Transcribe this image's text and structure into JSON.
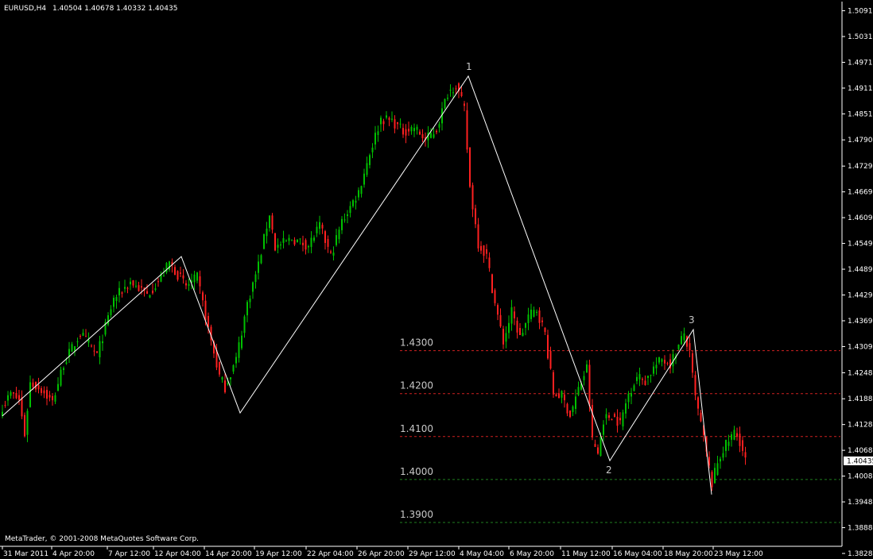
{
  "header": {
    "symbol": "EURUSD,H4",
    "quote": "1.40504 1.40678 1.40332 1.40435"
  },
  "footer": {
    "copyright": "MetaTrader, © 2001-2008 MetaQuotes Software Corp."
  },
  "colors": {
    "background": "#000000",
    "axis": "#ffffff",
    "bull_candle": "#00c000",
    "bear_candle": "#ff2020",
    "wick": "#00c000",
    "zigzag": "#ffffff",
    "resistance_line": "#d02020",
    "support_line": "#208020",
    "current_price_tag": "#ffffff"
  },
  "chart_data": {
    "type": "candlestick",
    "symbol": "EURUSD",
    "timeframe": "H4",
    "current_price": "1.40435",
    "ylim": [
      1.3828,
      1.5092
    ],
    "y_ticks": [
      "1.50910",
      "1.50310",
      "1.49710",
      "1.49110",
      "1.48510",
      "1.47905",
      "1.47295",
      "1.46695",
      "1.46095",
      "1.45495",
      "1.44895",
      "1.44295",
      "1.43695",
      "1.43095",
      "1.42485",
      "1.41880",
      "1.41280",
      "1.40680",
      "1.40080",
      "1.39480",
      "1.38880",
      "1.38280"
    ],
    "x_ticks": [
      "31 Mar 2011",
      "4 Apr 20:00",
      "7 Apr 12:00",
      "12 Apr 04:00",
      "14 Apr 20:00",
      "19 Apr 12:00",
      "22 Apr 04:00",
      "26 Apr 20:00",
      "29 Apr 12:00",
      "4 May 04:00",
      "6 May 20:00",
      "11 May 12:00",
      "16 May 04:00",
      "18 May 20:00",
      "23 May 12:00"
    ],
    "zigzag_path": [
      {
        "date": "31 Mar 2011",
        "price": 1.4148
      },
      {
        "date": "12 Apr 04:00",
        "price": 1.4519
      },
      {
        "date": "14 Apr 20:00",
        "price": 1.4155
      },
      {
        "date": "4 May 04:00",
        "price": 1.4939
      },
      {
        "date": "16 May 04:00",
        "price": 1.4044
      },
      {
        "date": "18 May 20:00",
        "price": 1.4349
      },
      {
        "date": "23 May 12:00",
        "price": 1.3965
      }
    ],
    "wave_labels": [
      {
        "label": "1",
        "price": 1.4939
      },
      {
        "label": "2",
        "price": 1.4044
      },
      {
        "label": "3",
        "price": 1.4349
      }
    ],
    "levels": [
      {
        "label": "1.4300",
        "price": 1.43,
        "kind": "resistance"
      },
      {
        "label": "1.4200",
        "price": 1.42,
        "kind": "resistance"
      },
      {
        "label": "1.4100",
        "price": 1.41,
        "kind": "resistance"
      },
      {
        "label": "1.4000",
        "price": 1.4,
        "kind": "support"
      },
      {
        "label": "1.3900",
        "price": 1.39,
        "kind": "support"
      }
    ],
    "close_waypoints": [
      [
        0,
        1.417
      ],
      [
        3,
        1.42
      ],
      [
        6,
        1.4185
      ],
      [
        8,
        1.4105
      ],
      [
        10,
        1.4225
      ],
      [
        14,
        1.421
      ],
      [
        18,
        1.418
      ],
      [
        22,
        1.427
      ],
      [
        28,
        1.434
      ],
      [
        34,
        1.429
      ],
      [
        40,
        1.442
      ],
      [
        46,
        1.446
      ],
      [
        52,
        1.443
      ],
      [
        57,
        1.447
      ],
      [
        60,
        1.4505
      ],
      [
        66,
        1.445
      ],
      [
        70,
        1.447
      ],
      [
        74,
        1.435
      ],
      [
        78,
        1.424
      ],
      [
        80,
        1.4215
      ],
      [
        84,
        1.428
      ],
      [
        88,
        1.441
      ],
      [
        92,
        1.45
      ],
      [
        96,
        1.462
      ],
      [
        98,
        1.454
      ],
      [
        104,
        1.456
      ],
      [
        110,
        1.4545
      ],
      [
        114,
        1.459
      ],
      [
        118,
        1.452
      ],
      [
        122,
        1.46
      ],
      [
        128,
        1.467
      ],
      [
        132,
        1.476
      ],
      [
        136,
        1.484
      ],
      [
        140,
        1.4835
      ],
      [
        144,
        1.481
      ],
      [
        148,
        1.482
      ],
      [
        152,
        1.479
      ],
      [
        156,
        1.4815
      ],
      [
        160,
        1.49
      ],
      [
        163,
        1.492
      ],
      [
        166,
        1.486
      ],
      [
        168,
        1.468
      ],
      [
        171,
        1.455
      ],
      [
        174,
        1.452
      ],
      [
        177,
        1.441
      ],
      [
        180,
        1.432
      ],
      [
        183,
        1.439
      ],
      [
        186,
        1.433
      ],
      [
        189,
        1.438
      ],
      [
        192,
        1.4395
      ],
      [
        195,
        1.434
      ],
      [
        198,
        1.42
      ],
      [
        201,
        1.4195
      ],
      [
        204,
        1.415
      ],
      [
        207,
        1.421
      ],
      [
        210,
        1.426
      ],
      [
        212,
        1.409
      ],
      [
        214,
        1.406
      ],
      [
        216,
        1.414
      ],
      [
        219,
        1.415
      ],
      [
        222,
        1.413
      ],
      [
        225,
        1.42
      ],
      [
        228,
        1.424
      ],
      [
        231,
        1.423
      ],
      [
        234,
        1.426
      ],
      [
        237,
        1.428
      ],
      [
        240,
        1.427
      ],
      [
        243,
        1.431
      ],
      [
        245,
        1.434
      ],
      [
        247,
        1.429
      ],
      [
        249,
        1.419
      ],
      [
        251,
        1.413
      ],
      [
        253,
        1.406
      ],
      [
        255,
        1.399
      ],
      [
        257,
        1.404
      ],
      [
        259,
        1.407
      ],
      [
        261,
        1.409
      ],
      [
        263,
        1.411
      ],
      [
        265,
        1.409
      ],
      [
        267,
        1.4043
      ]
    ]
  }
}
